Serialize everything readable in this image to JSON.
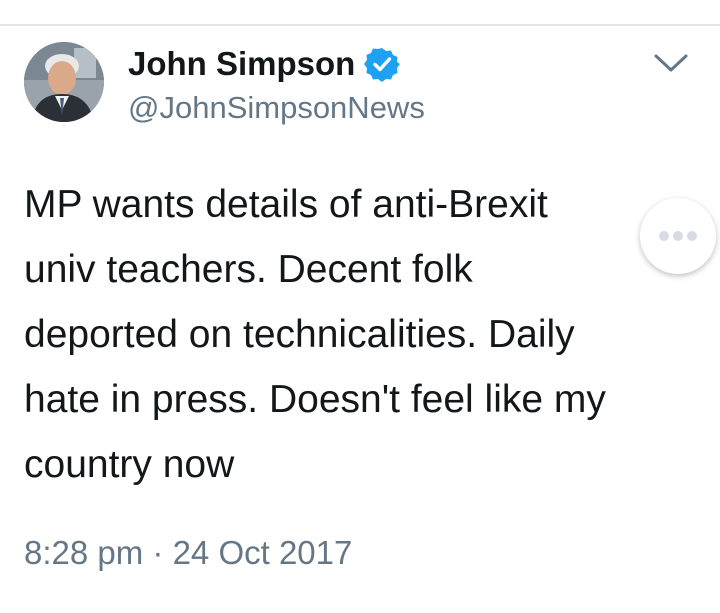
{
  "author": {
    "display_name": "John Simpson",
    "handle": "@JohnSimpsonNews",
    "verified": true
  },
  "tweet": {
    "text": "MP wants details of anti-Brexit\nuniv teachers. Decent folk\ndeported on technicalities. Daily\nhate in press. Doesn't feel like my\ncountry now",
    "timestamp": "8:28 pm · 24 Oct 2017"
  },
  "icons": {
    "verified": "verified-badge-icon",
    "menu": "chevron-down-icon",
    "more": "more-options-icon"
  },
  "colors": {
    "verified_blue": "#1da1f2",
    "secondary_text": "#657786",
    "primary_text": "#14171a"
  }
}
